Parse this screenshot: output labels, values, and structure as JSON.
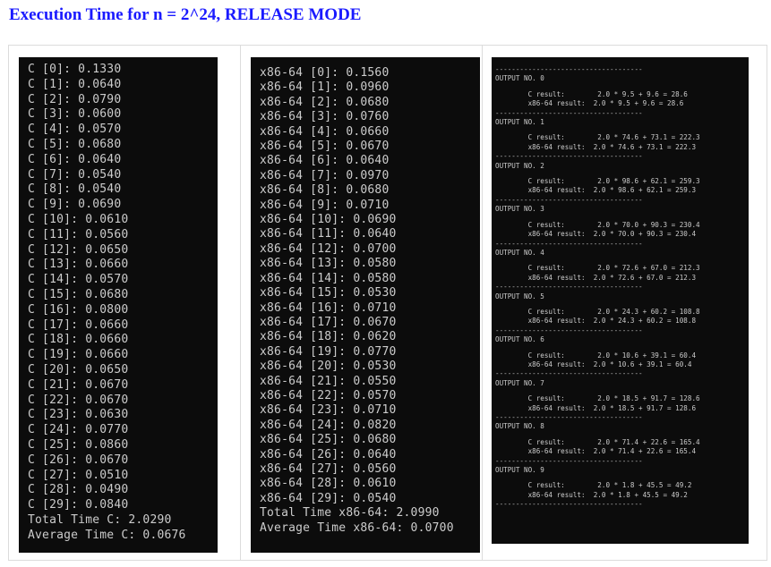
{
  "page_title": "Execution Time for n = 2^24, RELEASE MODE",
  "panel_c": {
    "lines": [
      "C [0]: 0.1330",
      "C [1]: 0.0640",
      "C [2]: 0.0790",
      "C [3]: 0.0600",
      "C [4]: 0.0570",
      "C [5]: 0.0680",
      "C [6]: 0.0640",
      "C [7]: 0.0540",
      "C [8]: 0.0540",
      "C [9]: 0.0690",
      "C [10]: 0.0610",
      "C [11]: 0.0560",
      "C [12]: 0.0650",
      "C [13]: 0.0660",
      "C [14]: 0.0570",
      "C [15]: 0.0680",
      "C [16]: 0.0800",
      "C [17]: 0.0660",
      "C [18]: 0.0660",
      "C [19]: 0.0660",
      "C [20]: 0.0650",
      "C [21]: 0.0670",
      "C [22]: 0.0670",
      "C [23]: 0.0630",
      "C [24]: 0.0770",
      "C [25]: 0.0860",
      "C [26]: 0.0670",
      "C [27]: 0.0510",
      "C [28]: 0.0490",
      "C [29]: 0.0840",
      "Total Time C: 2.0290",
      "Average Time C: 0.0676"
    ]
  },
  "panel_x86": {
    "lines": [
      "x86-64 [0]: 0.1560",
      "x86-64 [1]: 0.0960",
      "x86-64 [2]: 0.0680",
      "x86-64 [3]: 0.0760",
      "x86-64 [4]: 0.0660",
      "x86-64 [5]: 0.0670",
      "x86-64 [6]: 0.0640",
      "x86-64 [7]: 0.0970",
      "x86-64 [8]: 0.0680",
      "x86-64 [9]: 0.0710",
      "x86-64 [10]: 0.0690",
      "x86-64 [11]: 0.0640",
      "x86-64 [12]: 0.0700",
      "x86-64 [13]: 0.0580",
      "x86-64 [14]: 0.0580",
      "x86-64 [15]: 0.0530",
      "x86-64 [16]: 0.0710",
      "x86-64 [17]: 0.0670",
      "x86-64 [18]: 0.0620",
      "x86-64 [19]: 0.0770",
      "x86-64 [20]: 0.0530",
      "x86-64 [21]: 0.0550",
      "x86-64 [22]: 0.0570",
      "x86-64 [23]: 0.0710",
      "x86-64 [24]: 0.0820",
      "x86-64 [25]: 0.0680",
      "x86-64 [26]: 0.0640",
      "x86-64 [27]: 0.0560",
      "x86-64 [28]: 0.0610",
      "x86-64 [29]: 0.0540",
      "Total Time x86-64: 2.0990",
      "Average Time x86-64: 0.0700"
    ]
  },
  "panel_outputs": {
    "separator": "------------------------------------",
    "outputs": [
      {
        "header": "OUTPUT NO. 0",
        "c_result": "        C result:        2.0 * 9.5 + 9.6 = 28.6",
        "x86_result": "        x86-64 result:  2.0 * 9.5 + 9.6 = 28.6"
      },
      {
        "header": "OUTPUT NO. 1",
        "c_result": "        C result:        2.0 * 74.6 + 73.1 = 222.3",
        "x86_result": "        x86-64 result:  2.0 * 74.6 + 73.1 = 222.3"
      },
      {
        "header": "OUTPUT NO. 2",
        "c_result": "        C result:        2.0 * 98.6 + 62.1 = 259.3",
        "x86_result": "        x86-64 result:  2.0 * 98.6 + 62.1 = 259.3"
      },
      {
        "header": "OUTPUT NO. 3",
        "c_result": "        C result:        2.0 * 70.0 + 90.3 = 230.4",
        "x86_result": "        x86-64 result:  2.0 * 70.0 + 90.3 = 230.4"
      },
      {
        "header": "OUTPUT NO. 4",
        "c_result": "        C result:        2.0 * 72.6 + 67.0 = 212.3",
        "x86_result": "        x86-64 result:  2.0 * 72.6 + 67.0 = 212.3"
      },
      {
        "header": "OUTPUT NO. 5",
        "c_result": "        C result:        2.0 * 24.3 + 60.2 = 108.8",
        "x86_result": "        x86-64 result:  2.0 * 24.3 + 60.2 = 108.8"
      },
      {
        "header": "OUTPUT NO. 6",
        "c_result": "        C result:        2.0 * 10.6 + 39.1 = 60.4",
        "x86_result": "        x86-64 result:  2.0 * 10.6 + 39.1 = 60.4"
      },
      {
        "header": "OUTPUT NO. 7",
        "c_result": "        C result:        2.0 * 18.5 + 91.7 = 128.6",
        "x86_result": "        x86-64 result:  2.0 * 18.5 + 91.7 = 128.6"
      },
      {
        "header": "OUTPUT NO. 8",
        "c_result": "        C result:        2.0 * 71.4 + 22.6 = 165.4",
        "x86_result": "        x86-64 result:  2.0 * 71.4 + 22.6 = 165.4"
      },
      {
        "header": "OUTPUT NO. 9",
        "c_result": "        C result:        2.0 * 1.8 + 45.5 = 49.2",
        "x86_result": "        x86-64 result:  2.0 * 1.8 + 45.5 = 49.2"
      }
    ]
  }
}
